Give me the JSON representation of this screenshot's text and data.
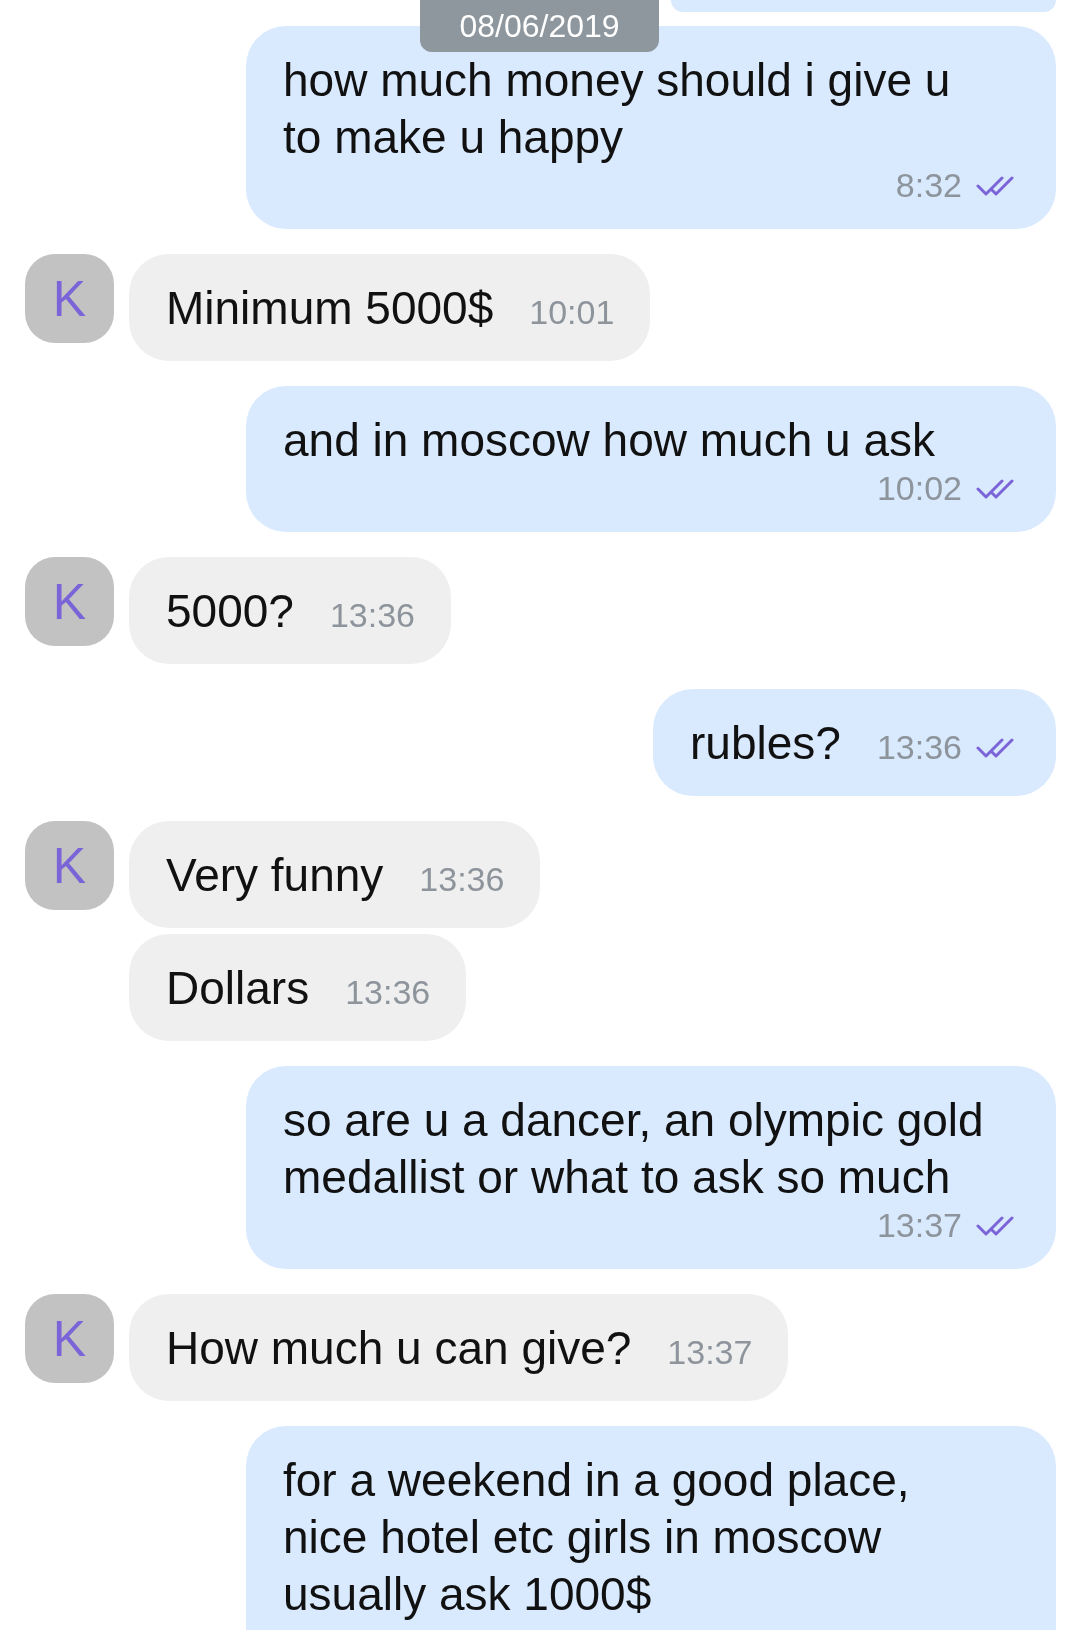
{
  "date_label": "08/06/2019",
  "messages": [
    {
      "kind": "outgoing",
      "text": "how much money should i give u to make u happy",
      "time": "8:32",
      "read": true
    },
    {
      "kind": "incoming",
      "avatar": "K",
      "text": "Minimum 5000$",
      "time": "10:01"
    },
    {
      "kind": "outgoing",
      "text": "and in moscow how much u ask",
      "time": "10:02",
      "read": true
    },
    {
      "kind": "incoming",
      "avatar": "K",
      "text": "5000?",
      "time": "13:36"
    },
    {
      "kind": "outgoing",
      "text": "rubles?",
      "time": "13:36",
      "read": true
    },
    {
      "kind": "incoming",
      "avatar": "K",
      "text": "Very funny",
      "time": "13:36"
    },
    {
      "kind": "incoming",
      "text": "Dollars",
      "time": "13:36"
    },
    {
      "kind": "outgoing",
      "text": "so are u a dancer, an olympic gold medallist or what to ask so much",
      "time": "13:37",
      "read": true
    },
    {
      "kind": "incoming",
      "avatar": "K",
      "text": "How much u can give?",
      "time": "13:37"
    },
    {
      "kind": "outgoing",
      "text": "for a weekend in a good place, nice hotel etc girls in moscow usually ask 1000$"
    }
  ]
}
